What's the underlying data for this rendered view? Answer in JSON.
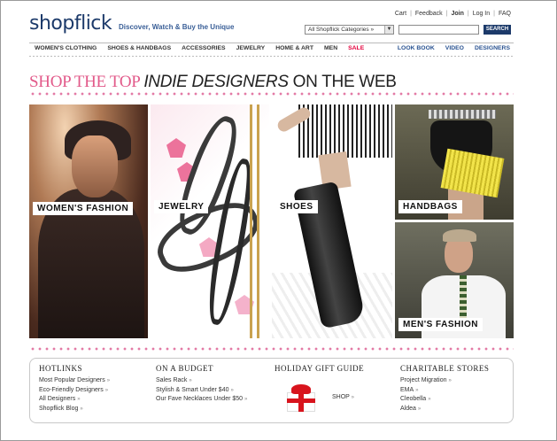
{
  "header": {
    "logo": "shopflick",
    "tagline": "Discover, Watch & Buy the Unique",
    "toplinks": [
      "Cart",
      "Feedback",
      "Join",
      "Log In",
      "FAQ"
    ],
    "category_select": "All Shopflick Categories »",
    "search_placeholder": "",
    "search_button": "SEARCH"
  },
  "nav": {
    "left": [
      "WOMEN'S CLOTHING",
      "SHOES & HANDBAGS",
      "ACCESSORIES",
      "JEWELRY",
      "HOME & ART",
      "MEN"
    ],
    "sale": "SALE",
    "right": [
      "LOOK BOOK",
      "VIDEO",
      "DESIGNERS"
    ]
  },
  "headline": {
    "part1": "SHOP THE TOP ",
    "part2": "INDIE DESIGNERS",
    "part3": " ON THE WEB"
  },
  "tiles": {
    "women": "WOMEN'S FASHION",
    "jewelry": "JEWELRY",
    "shoes": "SHOES",
    "handbags": "HANDBAGS",
    "men": "MEN'S FASHION"
  },
  "footer": {
    "hotlinks": {
      "title": "HOTLINKS",
      "items": [
        "Most Popular Designers",
        "Eco-Friendly Designers",
        "All Designers",
        "Shopflick Blog"
      ]
    },
    "budget": {
      "title": "ON A BUDGET",
      "items": [
        "Sales Rack",
        "Stylish & Smart Under $40",
        "Our Fave Necklaces Under $50"
      ]
    },
    "gift": {
      "title": "HOLIDAY GIFT GUIDE",
      "link": "SHOP"
    },
    "charity": {
      "title": "CHARITABLE STORES",
      "items": [
        "Project Migration",
        "EMA",
        "Cleobella",
        "Aldea"
      ]
    }
  },
  "colors": {
    "brand_navy": "#1c3a6a",
    "accent_pink": "#e25a8a",
    "sale_red": "#e4003c"
  }
}
